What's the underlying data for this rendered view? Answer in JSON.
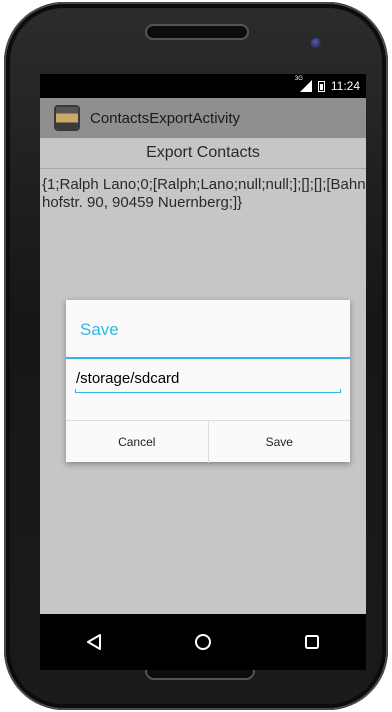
{
  "status_bar": {
    "network": "3G",
    "time": "11:24"
  },
  "app": {
    "title": "ContactsExportActivity"
  },
  "main": {
    "header": "Export Contacts",
    "contact_record": "{1;Ralph Lano;0;[Ralph;Lano;null;null;];[];[];[Bahnhofstr. 90, 90459 Nuernberg;]}"
  },
  "dialog": {
    "title": "Save",
    "path_value": "/storage/sdcard",
    "cancel_label": "Cancel",
    "save_label": "Save"
  },
  "nav": {
    "back_icon": "back-icon",
    "home_icon": "home-icon",
    "recents_icon": "recents-icon"
  },
  "colors": {
    "accent": "#33b5e5",
    "action_bar": "#8f8f8f",
    "dim_background": "#c6c6c6"
  }
}
